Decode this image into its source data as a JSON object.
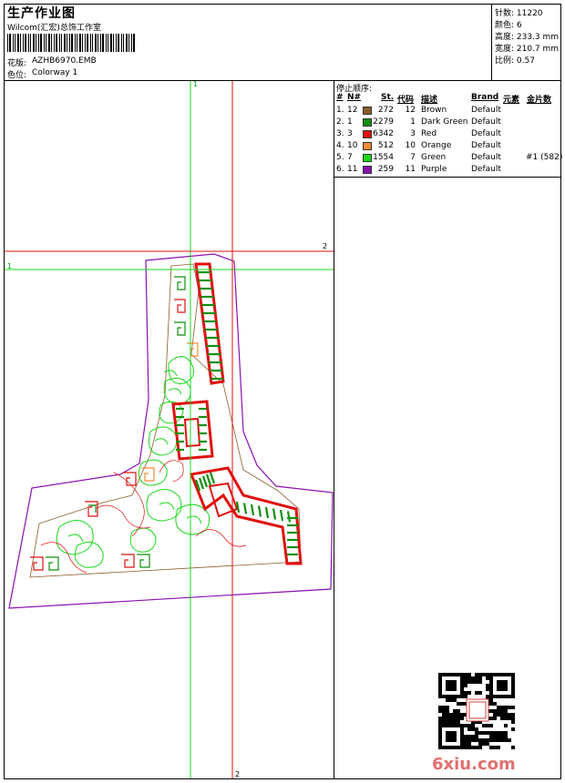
{
  "header": {
    "title": "生产作业图",
    "subtitle": "Wilcom(汇宏)总饰工作室",
    "design_label": "花版:",
    "design_value": "AZHB6970.EMB",
    "colorway_label": "色位:",
    "colorway_value": "Colorway 1"
  },
  "stats": {
    "stitches": "针数: 11220",
    "colors": "颜色: 6",
    "height": "高度: 233.3 mm",
    "width": "宽度: 210.7 mm",
    "scale": "比例: 0.57"
  },
  "sequence": {
    "title": "停止顺序:",
    "headers": [
      "#",
      "N#",
      "St.",
      "代码",
      "描述",
      "Brand",
      "元素",
      "金片数"
    ],
    "rows": [
      {
        "idx": "1.",
        "n": "12",
        "color": "#8B5A2B",
        "st": "272",
        "code": "12",
        "desc": "Brown",
        "brand": "Default",
        "element": "",
        "sequin": ""
      },
      {
        "idx": "2.",
        "n": "1",
        "color": "#0F8F0F",
        "st": "2279",
        "code": "1",
        "desc": "Dark Green",
        "brand": "Default",
        "element": "",
        "sequin": ""
      },
      {
        "idx": "3.",
        "n": "3",
        "color": "#E01010",
        "st": "6342",
        "code": "3",
        "desc": "Red",
        "brand": "Default",
        "element": "",
        "sequin": ""
      },
      {
        "idx": "4.",
        "n": "10",
        "color": "#F08C30",
        "st": "512",
        "code": "10",
        "desc": "Orange",
        "brand": "Default",
        "element": "",
        "sequin": ""
      },
      {
        "idx": "5.",
        "n": "7",
        "color": "#18D818",
        "st": "1554",
        "code": "7",
        "desc": "Green",
        "brand": "Default",
        "element": "#1 (582)",
        "sequin": ""
      },
      {
        "idx": "6.",
        "n": "11",
        "color": "#8A10B0",
        "st": "259",
        "code": "11",
        "desc": "Purple",
        "brand": "Default",
        "element": "",
        "sequin": ""
      }
    ]
  },
  "guides": {
    "green_top": "1",
    "green_left": "1",
    "red_right": "2",
    "red_bottom": "2"
  },
  "watermark": "6xiu.com"
}
